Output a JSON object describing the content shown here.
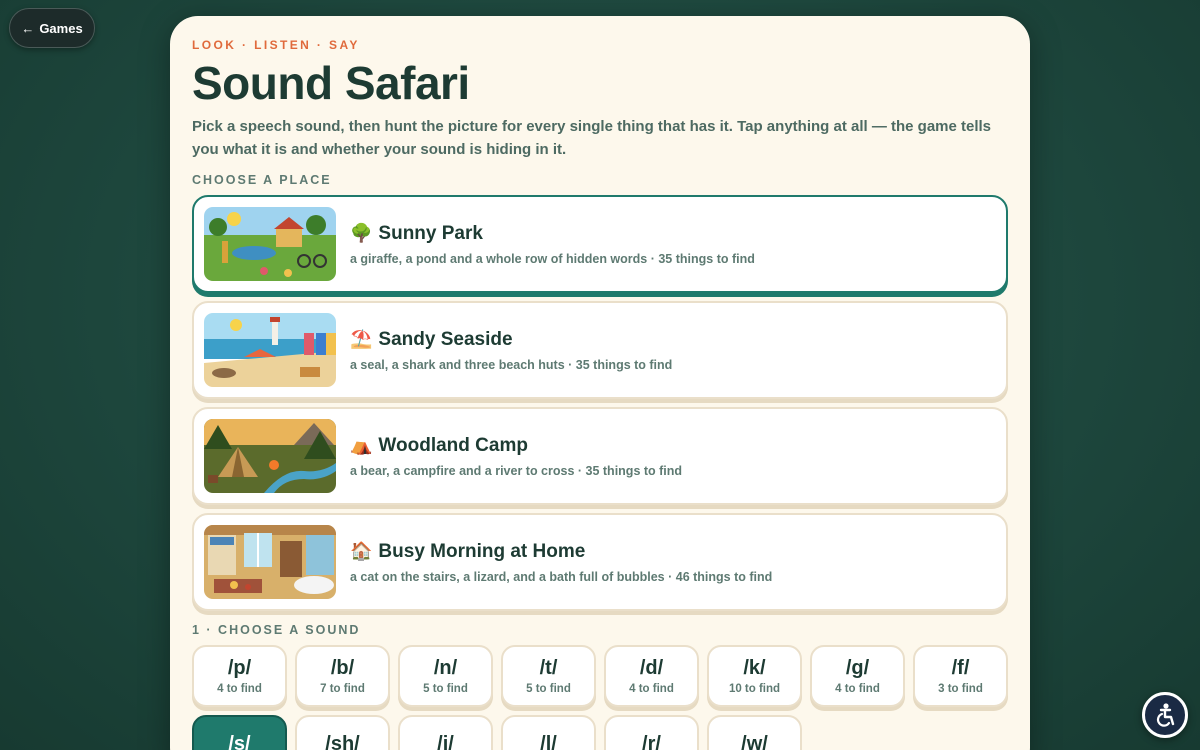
{
  "nav": {
    "back_arrow": "←",
    "back_label": "Games"
  },
  "header": {
    "eyebrow": "LOOK · LISTEN · SAY",
    "title": "Sound Safari",
    "intro": "Pick a speech sound, then hunt the picture for every single thing that has it. Tap anything at all — the game tells you what it is and whether your sound is hiding in it."
  },
  "places_label": "CHOOSE A PLACE",
  "places": [
    {
      "emoji": "🌳",
      "title": "Sunny Park",
      "desc": "a giraffe, a pond and a whole row of hidden words · 35 things to find",
      "selected": true,
      "icon": "park-scene-thumbnail"
    },
    {
      "emoji": "⛱️",
      "title": "Sandy Seaside",
      "desc": "a seal, a shark and three beach huts · 35 things to find",
      "selected": false,
      "icon": "seaside-scene-thumbnail"
    },
    {
      "emoji": "⛺",
      "title": "Woodland Camp",
      "desc": "a bear, a campfire and a river to cross · 35 things to find",
      "selected": false,
      "icon": "woodland-scene-thumbnail"
    },
    {
      "emoji": "🏠",
      "title": "Busy Morning at Home",
      "desc": "a cat on the stairs, a lizard, and a bath full of bubbles · 46 things to find",
      "selected": false,
      "icon": "home-scene-thumbnail"
    }
  ],
  "sounds_label": "1 · CHOOSE A SOUND",
  "sounds": [
    {
      "label": "/p/",
      "count": "4 to find",
      "selected": false
    },
    {
      "label": "/b/",
      "count": "7 to find",
      "selected": false
    },
    {
      "label": "/n/",
      "count": "5 to find",
      "selected": false
    },
    {
      "label": "/t/",
      "count": "5 to find",
      "selected": false
    },
    {
      "label": "/d/",
      "count": "4 to find",
      "selected": false
    },
    {
      "label": "/k/",
      "count": "10 to find",
      "selected": false
    },
    {
      "label": "/g/",
      "count": "4 to find",
      "selected": false
    },
    {
      "label": "/f/",
      "count": "3 to find",
      "selected": false
    },
    {
      "label": "/s/",
      "count": "",
      "selected": true
    },
    {
      "label": "/sh/",
      "count": "",
      "selected": false
    },
    {
      "label": "/j/",
      "count": "",
      "selected": false
    },
    {
      "label": "/l/",
      "count": "",
      "selected": false
    },
    {
      "label": "/r/",
      "count": "",
      "selected": false
    },
    {
      "label": "/w/",
      "count": "",
      "selected": false
    }
  ],
  "accessibility": {
    "icon": "accessibility-icon"
  },
  "colors": {
    "accent": "#1f7a6c",
    "eyebrow": "#e06a3c",
    "card": "#fdf8ec",
    "heading": "#1d3b33"
  }
}
